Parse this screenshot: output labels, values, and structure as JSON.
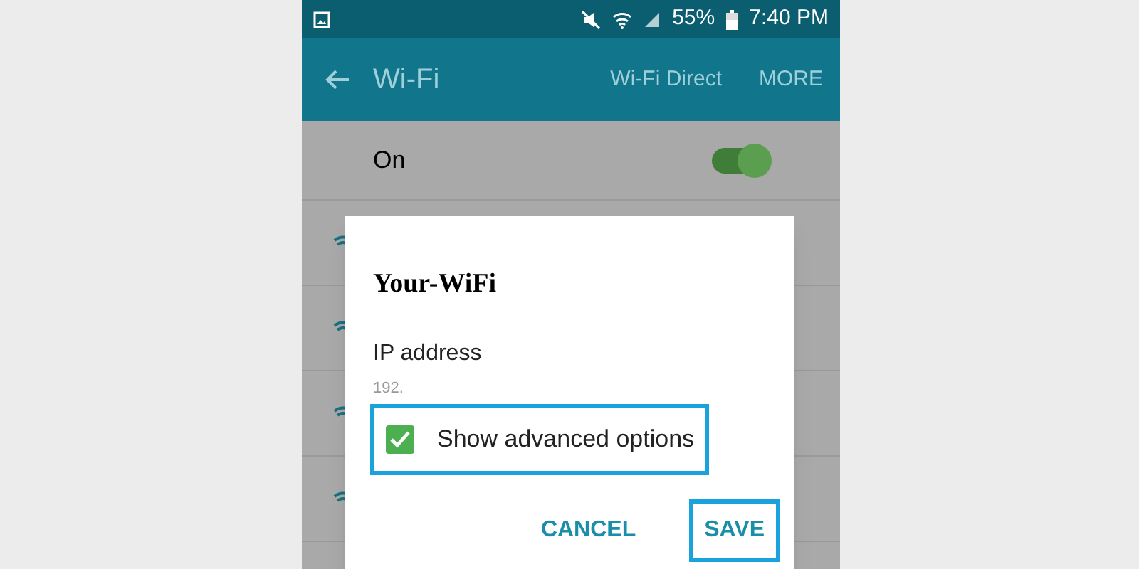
{
  "status_bar": {
    "battery": "55%",
    "time": "7:40 PM"
  },
  "app_bar": {
    "title": "Wi-Fi",
    "actions": [
      "Wi-Fi Direct",
      "MORE"
    ]
  },
  "wifi_switch": {
    "label": "On",
    "on": true
  },
  "dialog": {
    "title": "Your-WiFi",
    "field_label": "IP address",
    "field_value": "192.",
    "checkbox": {
      "label": "Show advanced options",
      "checked": true,
      "highlighted": true
    },
    "buttons": [
      {
        "label": "CANCEL",
        "highlighted": false
      },
      {
        "label": "SAVE",
        "highlighted": true
      }
    ]
  }
}
